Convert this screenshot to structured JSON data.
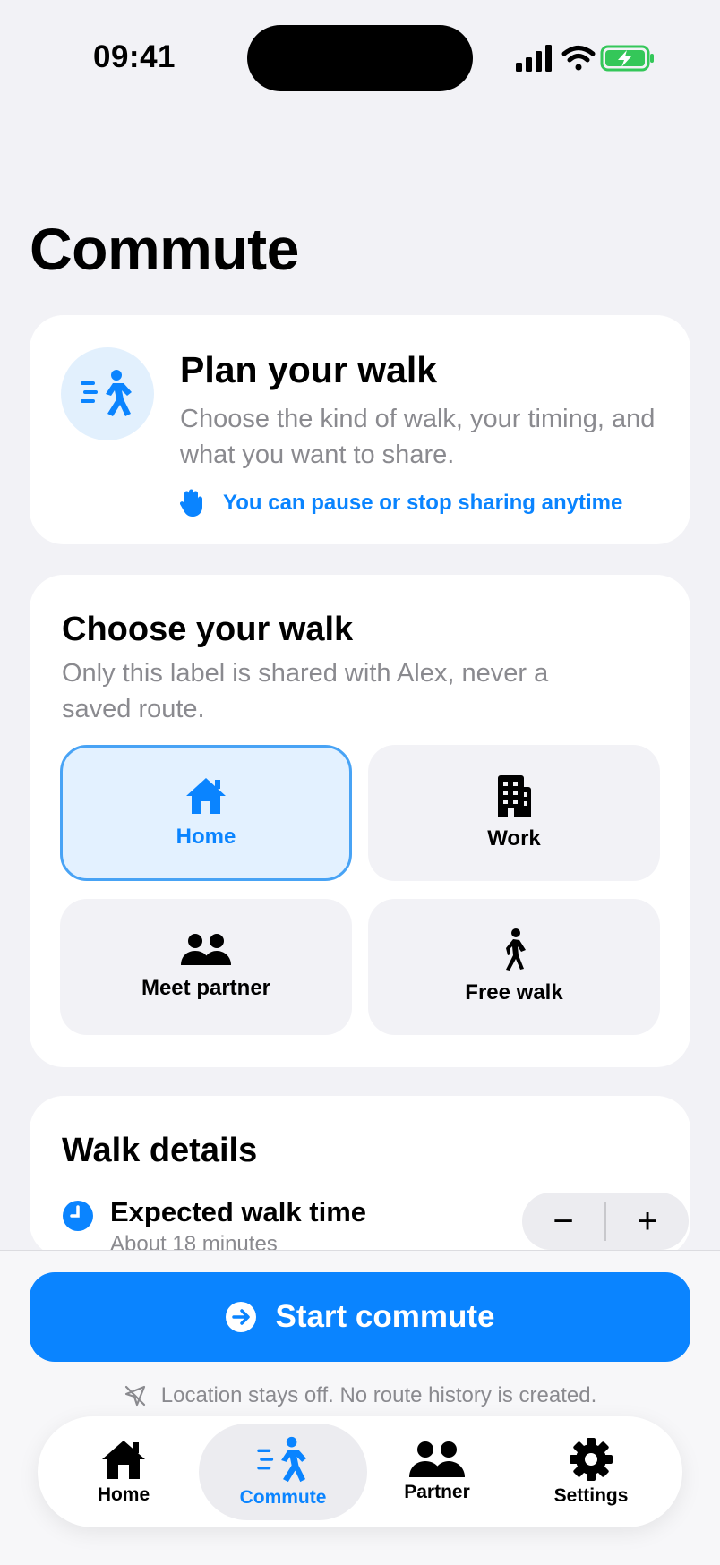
{
  "status_bar": {
    "time": "09:41"
  },
  "header": {
    "title": "Commute"
  },
  "plan_card": {
    "title": "Plan your walk",
    "description": "Choose the kind of walk, your timing, and what you want to share.",
    "note": "You can pause or stop sharing anytime",
    "icon": "walking-person-icon"
  },
  "choose_card": {
    "title": "Choose your walk",
    "subtitle": "Only this label is shared with Alex, never a saved route.",
    "options": [
      {
        "label": "Home",
        "icon": "house-icon",
        "selected": true
      },
      {
        "label": "Work",
        "icon": "building-icon",
        "selected": false
      },
      {
        "label": "Meet partner",
        "icon": "people-icon",
        "selected": false
      },
      {
        "label": "Free walk",
        "icon": "walking-icon",
        "selected": false
      }
    ]
  },
  "details_card": {
    "title": "Walk details",
    "walk_time": {
      "label": "Expected walk time",
      "value": "About 18 minutes",
      "decrement": "−",
      "increment": "+"
    }
  },
  "actions": {
    "start_label": "Start commute",
    "privacy_note": "Location stays off. No route history is created."
  },
  "tab_bar": {
    "items": [
      {
        "label": "Home",
        "icon": "house-icon",
        "active": false
      },
      {
        "label": "Commute",
        "icon": "walking-person-icon",
        "active": true
      },
      {
        "label": "Partner",
        "icon": "people-icon",
        "active": false
      },
      {
        "label": "Settings",
        "icon": "gear-icon",
        "active": false
      }
    ]
  },
  "colors": {
    "accent": "#0a84ff",
    "background": "#f2f2f6",
    "selected_fill": "#e3f1ff",
    "battery": "#34c759"
  }
}
